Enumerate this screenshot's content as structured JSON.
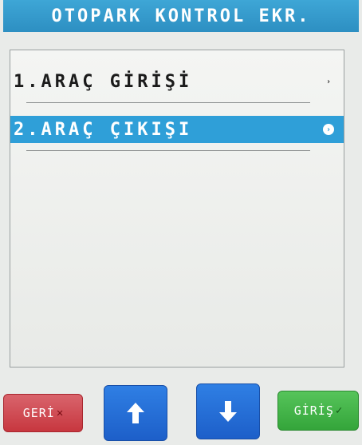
{
  "header": {
    "title": "OTOPARK KONTROL EKR."
  },
  "menu": {
    "items": [
      {
        "label": "1.ARAÇ GİRİŞİ",
        "selected": false
      },
      {
        "label": "2.ARAÇ ÇIKIŞI",
        "selected": true
      }
    ]
  },
  "buttons": {
    "back_label": "GERİ",
    "enter_label": "GİRİŞ"
  },
  "icons": {
    "chevron": "chevron-right-icon",
    "up": "arrow-up-icon",
    "down": "arrow-down-icon",
    "back_mark": "x-mark-icon",
    "enter_mark": "check-mark-icon"
  },
  "colors": {
    "title_bar": "#3ea6d6",
    "selection": "#2f9fd8",
    "back_button": "#c7373f",
    "arrow_buttons": "#1d5fc9",
    "enter_button": "#34a53a"
  }
}
